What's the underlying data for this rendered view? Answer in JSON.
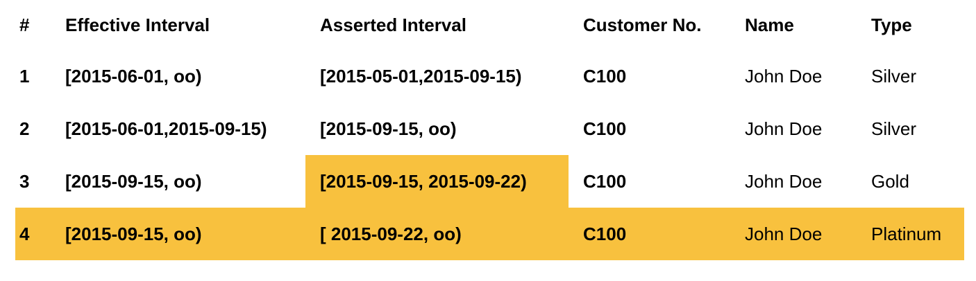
{
  "columns": {
    "num": "#",
    "effective": "Effective Interval",
    "asserted": "Asserted Interval",
    "customer": "Customer No.",
    "name": "Name",
    "type": "Type"
  },
  "rows": [
    {
      "num": "1",
      "effective": "[2015-06-01, oo)",
      "asserted": "[2015-05-01,2015-09-15)",
      "customer": "C100",
      "name": "John Doe",
      "type": "Silver"
    },
    {
      "num": "2",
      "effective": "[2015-06-01,2015-09-15)",
      "asserted": "[2015-09-15, oo)",
      "customer": "C100",
      "name": "John Doe",
      "type": "Silver"
    },
    {
      "num": "3",
      "effective": "[2015-09-15, oo)",
      "asserted": "[2015-09-15, 2015-09-22)",
      "customer": "C100",
      "name": "John Doe",
      "type": "Gold"
    },
    {
      "num": "4",
      "effective": "[2015-09-15, oo)",
      "asserted": "[ 2015-09-22, oo)",
      "customer": "C100",
      "name": "John Doe",
      "type": "Platinum"
    }
  ],
  "colors": {
    "highlight": "#f8c13e"
  }
}
